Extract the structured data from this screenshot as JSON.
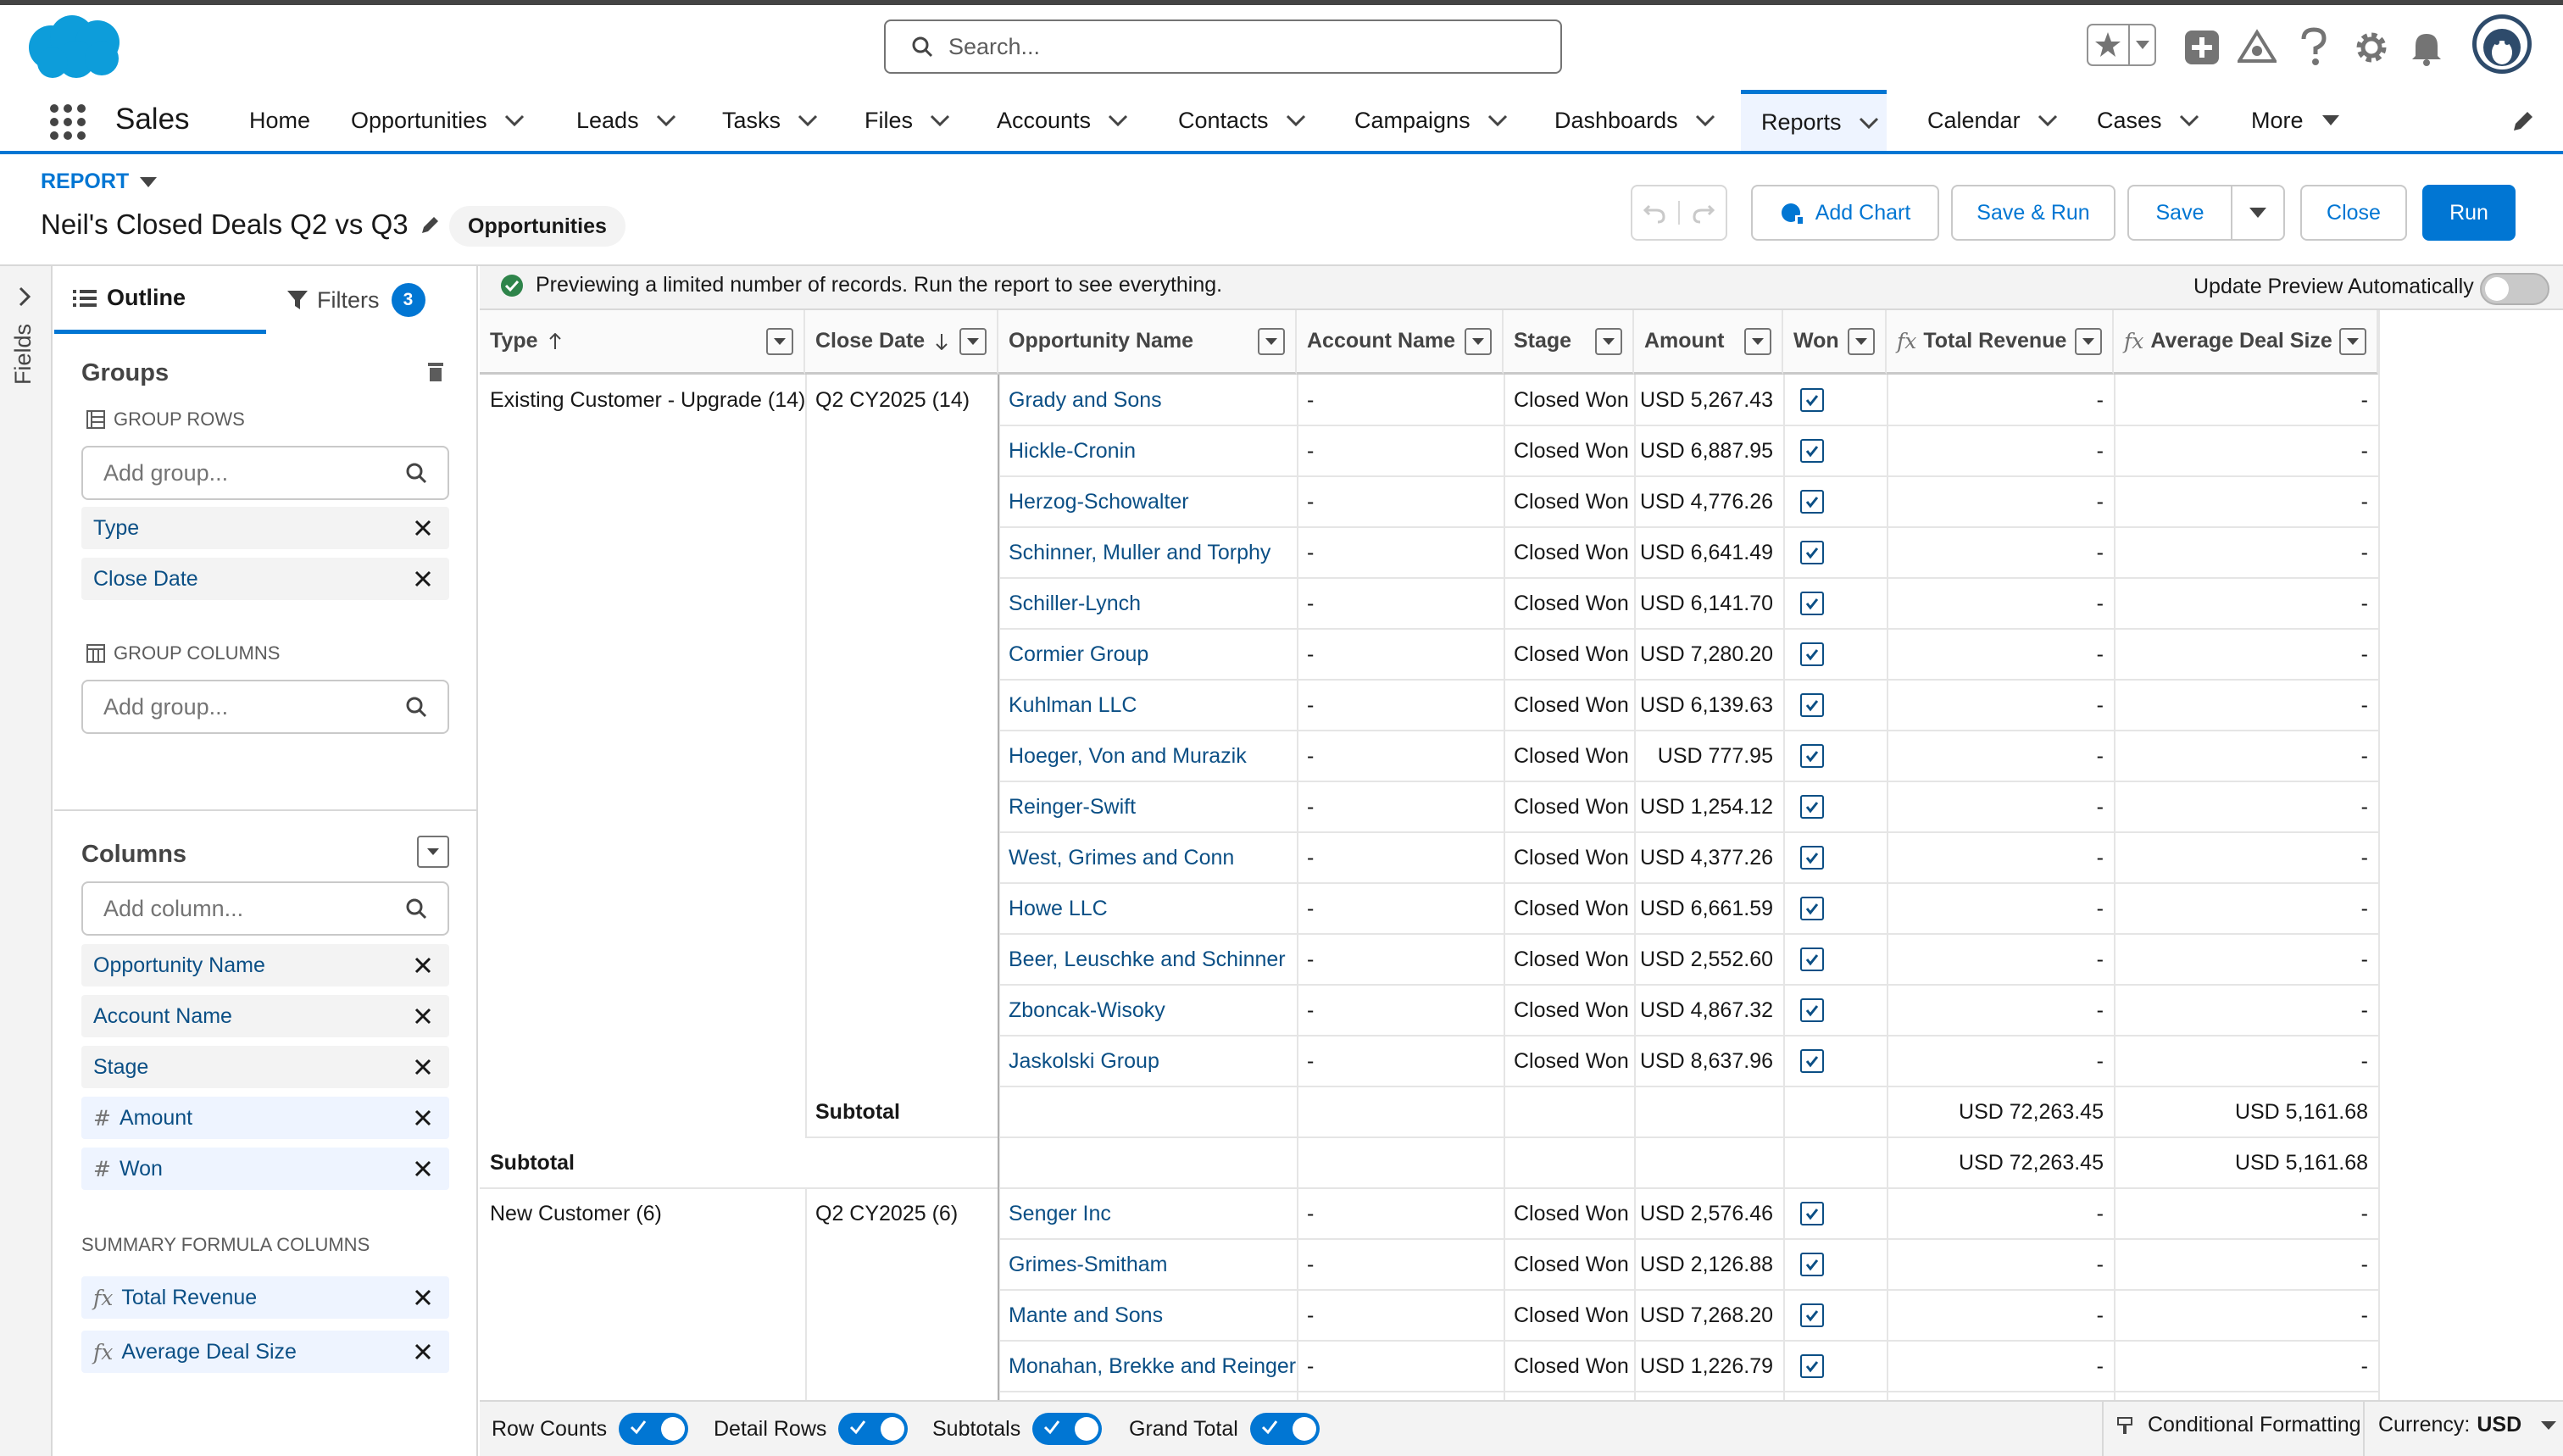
{
  "app": {
    "name": "Sales",
    "search_placeholder": "Search..."
  },
  "nav": {
    "items": [
      {
        "label": "Home"
      },
      {
        "label": "Opportunities"
      },
      {
        "label": "Leads"
      },
      {
        "label": "Tasks"
      },
      {
        "label": "Files"
      },
      {
        "label": "Accounts"
      },
      {
        "label": "Contacts"
      },
      {
        "label": "Campaigns"
      },
      {
        "label": "Dashboards"
      },
      {
        "label": "Reports"
      },
      {
        "label": "Calendar"
      },
      {
        "label": "Cases"
      },
      {
        "label": "More"
      }
    ],
    "active": "Reports"
  },
  "report": {
    "label": "REPORT",
    "title": "Neil's Closed Deals Q2 vs Q3",
    "type": "Opportunities",
    "buttons": {
      "add_chart": "Add Chart",
      "save_run": "Save & Run",
      "save": "Save",
      "close": "Close",
      "run": "Run"
    }
  },
  "rail": {
    "label": "Fields"
  },
  "panel": {
    "tabs": {
      "outline": "Outline",
      "filters": "Filters",
      "filter_count": "3"
    },
    "groups_title": "Groups",
    "group_rows_label": "GROUP ROWS",
    "group_rows_placeholder": "Add group...",
    "group_rows": [
      "Type",
      "Close Date"
    ],
    "group_columns_label": "GROUP COLUMNS",
    "group_columns_placeholder": "Add group...",
    "columns_title": "Columns",
    "columns_placeholder": "Add column...",
    "columns": [
      {
        "label": "Opportunity Name",
        "prefix": ""
      },
      {
        "label": "Account Name",
        "prefix": ""
      },
      {
        "label": "Stage",
        "prefix": ""
      },
      {
        "label": "Amount",
        "prefix": "#"
      },
      {
        "label": "Won",
        "prefix": "#"
      }
    ],
    "summary_label": "SUMMARY FORMULA COLUMNS",
    "summary_columns": [
      {
        "label": "Total Revenue",
        "prefix": "fx"
      },
      {
        "label": "Average Deal Size",
        "prefix": "fx"
      }
    ]
  },
  "preview": {
    "message": "Previewing a limited number of records. Run the report to see everything.",
    "toggle_label": "Update Preview Automatically"
  },
  "table": {
    "headers": {
      "type": "Type",
      "close_date": "Close Date",
      "opportunity_name": "Opportunity Name",
      "account_name": "Account Name",
      "stage": "Stage",
      "amount": "Amount",
      "won": "Won",
      "total_revenue": "Total Revenue",
      "average_deal_size": "Average Deal Size"
    },
    "group1": {
      "type": "Existing Customer - Upgrade (14)",
      "close_date": "Q2 CY2025 (14)",
      "rows": [
        {
          "name": "Grady and Sons",
          "account": "-",
          "stage": "Closed Won",
          "amount": "USD 5,267.43",
          "total": "-",
          "avg": "-"
        },
        {
          "name": "Hickle-Cronin",
          "account": "-",
          "stage": "Closed Won",
          "amount": "USD 6,887.95",
          "total": "-",
          "avg": "-"
        },
        {
          "name": "Herzog-Schowalter",
          "account": "-",
          "stage": "Closed Won",
          "amount": "USD 4,776.26",
          "total": "-",
          "avg": "-"
        },
        {
          "name": "Schinner, Muller and Torphy",
          "account": "-",
          "stage": "Closed Won",
          "amount": "USD 6,641.49",
          "total": "-",
          "avg": "-"
        },
        {
          "name": "Schiller-Lynch",
          "account": "-",
          "stage": "Closed Won",
          "amount": "USD 6,141.70",
          "total": "-",
          "avg": "-"
        },
        {
          "name": "Cormier Group",
          "account": "-",
          "stage": "Closed Won",
          "amount": "USD 7,280.20",
          "total": "-",
          "avg": "-"
        },
        {
          "name": "Kuhlman LLC",
          "account": "-",
          "stage": "Closed Won",
          "amount": "USD 6,139.63",
          "total": "-",
          "avg": "-"
        },
        {
          "name": "Hoeger, Von and Murazik",
          "account": "-",
          "stage": "Closed Won",
          "amount": "USD 777.95",
          "total": "-",
          "avg": "-"
        },
        {
          "name": "Reinger-Swift",
          "account": "-",
          "stage": "Closed Won",
          "amount": "USD 1,254.12",
          "total": "-",
          "avg": "-"
        },
        {
          "name": "West, Grimes and Conn",
          "account": "-",
          "stage": "Closed Won",
          "amount": "USD 4,377.26",
          "total": "-",
          "avg": "-"
        },
        {
          "name": "Howe LLC",
          "account": "-",
          "stage": "Closed Won",
          "amount": "USD 6,661.59",
          "total": "-",
          "avg": "-"
        },
        {
          "name": "Beer, Leuschke and Schinner",
          "account": "-",
          "stage": "Closed Won",
          "amount": "USD 2,552.60",
          "total": "-",
          "avg": "-"
        },
        {
          "name": "Zboncak-Wisoky",
          "account": "-",
          "stage": "Closed Won",
          "amount": "USD 4,867.32",
          "total": "-",
          "avg": "-"
        },
        {
          "name": "Jaskolski Group",
          "account": "-",
          "stage": "Closed Won",
          "amount": "USD 8,637.96",
          "total": "-",
          "avg": "-"
        }
      ],
      "inner_subtotal": {
        "label": "Subtotal",
        "total": "USD 72,263.45",
        "avg": "USD 5,161.68"
      },
      "outer_subtotal": {
        "label": "Subtotal",
        "total": "USD 72,263.45",
        "avg": "USD 5,161.68"
      }
    },
    "group2": {
      "type": "New Customer (6)",
      "close_date": "Q2 CY2025 (6)",
      "rows": [
        {
          "name": "Senger Inc",
          "account": "-",
          "stage": "Closed Won",
          "amount": "USD 2,576.46",
          "total": "-",
          "avg": "-"
        },
        {
          "name": "Grimes-Smitham",
          "account": "-",
          "stage": "Closed Won",
          "amount": "USD 2,126.88",
          "total": "-",
          "avg": "-"
        },
        {
          "name": "Mante and Sons",
          "account": "-",
          "stage": "Closed Won",
          "amount": "USD 7,268.20",
          "total": "-",
          "avg": "-"
        },
        {
          "name": "Monahan, Brekke and Reinger",
          "account": "-",
          "stage": "Closed Won",
          "amount": "USD 1,226.79",
          "total": "-",
          "avg": "-"
        }
      ]
    }
  },
  "bottom": {
    "row_counts": "Row Counts",
    "detail_rows": "Detail Rows",
    "subtotals": "Subtotals",
    "grand_total": "Grand Total",
    "conditional_formatting": "Conditional Formatting",
    "currency_label": "Currency:",
    "currency_value": "USD"
  }
}
